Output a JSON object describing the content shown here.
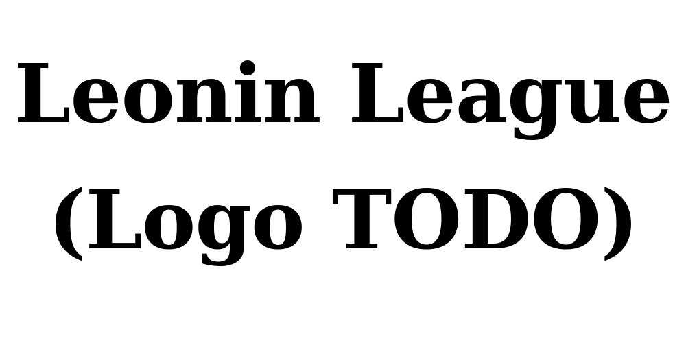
{
  "logo": {
    "line1": "Leonin League",
    "line2": "(Logo TODO)",
    "text_color": "#000000",
    "background_color": "#ffffff"
  }
}
